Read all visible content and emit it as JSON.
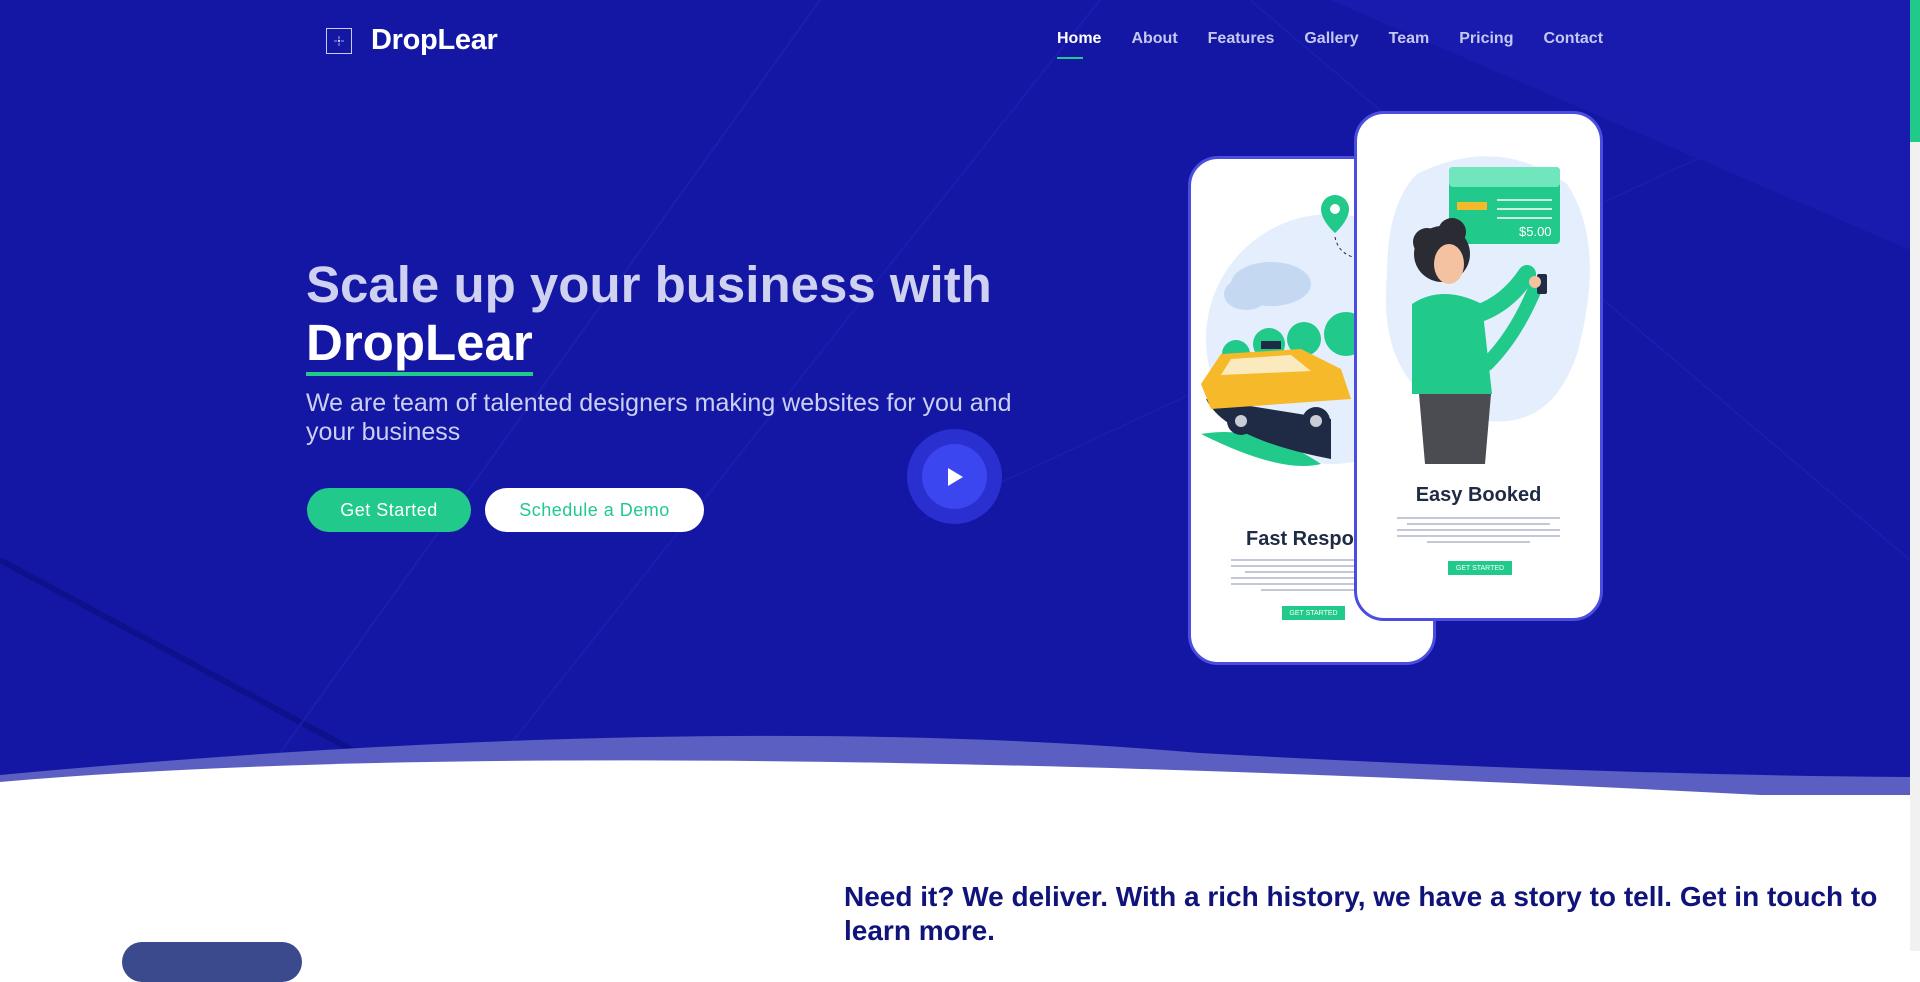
{
  "brand": {
    "name": "DropLear"
  },
  "nav": {
    "items": [
      {
        "label": "Home",
        "active": true
      },
      {
        "label": "About"
      },
      {
        "label": "Features"
      },
      {
        "label": "Gallery"
      },
      {
        "label": "Team"
      },
      {
        "label": "Pricing"
      },
      {
        "label": "Contact"
      }
    ]
  },
  "hero": {
    "headline_prefix": "Scale up your business with",
    "headline_brand": "DropLear",
    "subtitle": "We are team of talented designers making websites for you and your business",
    "primary_button": "Get Started",
    "secondary_button": "Schedule a Demo",
    "play_icon": "play-icon"
  },
  "phones": {
    "left": {
      "title": "Fast Respon",
      "button": "GET STARTED"
    },
    "right": {
      "title": "Easy Booked",
      "button": "GET STARTED",
      "price": "$5.00"
    }
  },
  "about": {
    "heading": "Need it? We deliver. With a rich history, we have a story to tell. Get in touch to learn more."
  },
  "colors": {
    "hero_bg": "#1417a3",
    "accent": "#21c98a",
    "heading_dark": "#0f137a",
    "phone_border": "#4a4de0"
  }
}
